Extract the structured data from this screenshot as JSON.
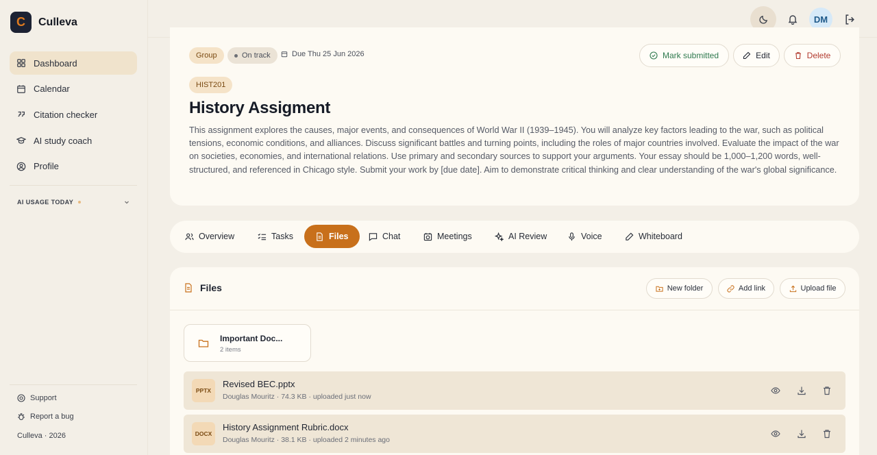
{
  "app": {
    "name": "Culleva",
    "logo_letter": "C"
  },
  "sidebar": {
    "items": [
      {
        "label": "Dashboard",
        "icon": "dashboard-icon",
        "active": true
      },
      {
        "label": "Calendar",
        "icon": "calendar-icon"
      },
      {
        "label": "Citation checker",
        "icon": "quote-icon"
      },
      {
        "label": "AI study coach",
        "icon": "graduation-cap-icon"
      },
      {
        "label": "Profile",
        "icon": "user-circle-icon"
      }
    ],
    "ai_usage_label": "AI USAGE TODAY",
    "footer": {
      "support": "Support",
      "report_bug": "Report a bug",
      "copyright": "Culleva · 2026"
    }
  },
  "topbar": {
    "avatar_initials": "DM"
  },
  "assignment": {
    "group_chip": "Group",
    "status_chip": "On track",
    "due": "Due Thu 25 Jun 2026",
    "course_code": "HIST201",
    "title": "History Assigment",
    "description": "This assignment explores the causes, major events, and consequences of World War II (1939–1945). You will analyze key factors leading to the war, such as political tensions, economic conditions, and alliances. Discuss significant battles and turning points, including the roles of major countries involved. Evaluate the impact of the war on societies, economies, and international relations. Use primary and secondary sources to support your arguments. Your essay should be 1,000–1,200 words, well-structured, and referenced in Chicago style. Submit your work by [due date]. Aim to demonstrate critical thinking and clear understanding of the war's global significance.",
    "actions": {
      "mark_submitted": "Mark submitted",
      "edit": "Edit",
      "delete": "Delete"
    }
  },
  "tabs": [
    {
      "label": "Overview",
      "icon": "users-icon"
    },
    {
      "label": "Tasks",
      "icon": "checklist-icon"
    },
    {
      "label": "Files",
      "icon": "file-icon",
      "active": true
    },
    {
      "label": "Chat",
      "icon": "chat-icon"
    },
    {
      "label": "Meetings",
      "icon": "calendar-clock-icon"
    },
    {
      "label": "AI Review",
      "icon": "sparkles-icon"
    },
    {
      "label": "Voice",
      "icon": "microphone-icon"
    },
    {
      "label": "Whiteboard",
      "icon": "pencil-icon"
    }
  ],
  "files": {
    "heading": "Files",
    "actions": {
      "new_folder": "New folder",
      "add_link": "Add link",
      "upload_file": "Upload file"
    },
    "folders": [
      {
        "name": "Important Doc...",
        "count": "2 items"
      }
    ],
    "items": [
      {
        "type": "PPTX",
        "name": "Revised BEC.pptx",
        "meta": "Douglas Mouritz · 74.3 KB · uploaded just now"
      },
      {
        "type": "DOCX",
        "name": "History Assignment Rubric.docx",
        "meta": "Douglas Mouritz · 38.1 KB · uploaded 2 minutes ago"
      }
    ]
  },
  "colors": {
    "accent": "#c8701b",
    "background": "#f3efe7",
    "card": "#fdfaf3",
    "success": "#2f7a4f",
    "danger": "#b23a2e"
  }
}
